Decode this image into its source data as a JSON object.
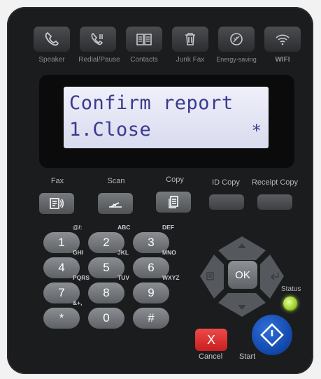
{
  "top_buttons": [
    {
      "label": "Speaker",
      "icon": "phone-icon"
    },
    {
      "label": "Redial/Pause",
      "icon": "redial-icon"
    },
    {
      "label": "Contacts",
      "icon": "book-icon"
    },
    {
      "label": "Junk Fax",
      "icon": "trash-icon"
    },
    {
      "label": "Energy-saving",
      "icon": "leaf-icon"
    },
    {
      "label": "WIFI",
      "icon": "wifi-icon"
    }
  ],
  "lcd": {
    "line1": "Confirm report",
    "line2": "1.Close",
    "indicator": "*"
  },
  "function_buttons": [
    {
      "label": "Fax",
      "icon": "fax-icon"
    },
    {
      "label": "Scan",
      "icon": "scan-icon"
    },
    {
      "label": "Copy",
      "icon": "copy-icon"
    },
    {
      "label": "ID Copy"
    },
    {
      "label": "Receipt Copy"
    }
  ],
  "keypad": [
    {
      "digit": "1",
      "letters": "@/:"
    },
    {
      "digit": "2",
      "letters": "ABC"
    },
    {
      "digit": "3",
      "letters": "DEF"
    },
    {
      "digit": "4",
      "letters": "GHI"
    },
    {
      "digit": "5",
      "letters": "JKL"
    },
    {
      "digit": "6",
      "letters": "MNO"
    },
    {
      "digit": "7",
      "letters": "PQRS"
    },
    {
      "digit": "8",
      "letters": "TUV"
    },
    {
      "digit": "9",
      "letters": "WXYZ"
    },
    {
      "digit": "*",
      "letters": "&+,"
    },
    {
      "digit": "0",
      "letters": ""
    },
    {
      "digit": "#",
      "letters": ""
    }
  ],
  "nav": {
    "ok_label": "OK"
  },
  "status": {
    "label": "Status",
    "led_color": "#9ad12a"
  },
  "cancel": {
    "symbol": "X",
    "label": "Cancel",
    "color": "#e03030"
  },
  "start": {
    "label": "Start",
    "color": "#1a55c0"
  }
}
